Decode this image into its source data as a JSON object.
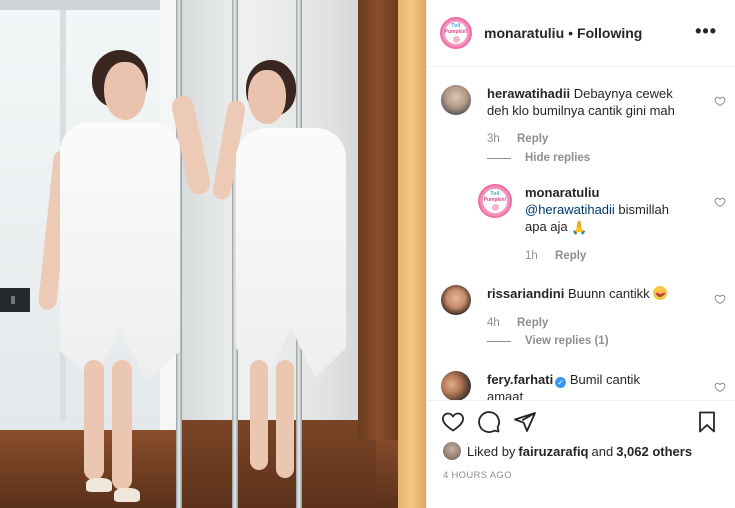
{
  "post": {
    "author": "monaratuliu",
    "separator": "•",
    "follow_status": "Following",
    "more_label": "•••",
    "avatar_text": [
      "Toll",
      "Pumpkin!"
    ]
  },
  "comments": [
    {
      "username": "herawatihadii",
      "text": "Debaynya cewek deh klo bumilnya cantik gini mah",
      "time": "3h",
      "reply_label": "Reply",
      "hide_replies_label": "Hide replies"
    },
    {
      "username": "monaratuliu",
      "mention": "@herawatihadii",
      "text": " bismillah apa aja ",
      "emoji": "🙏",
      "time": "1h",
      "reply_label": "Reply"
    },
    {
      "username": "rissariandini",
      "text": "Buunn cantikk ",
      "emoji": "heart-eyes",
      "time": "4h",
      "reply_label": "Reply",
      "view_replies_label": "View replies (1)"
    },
    {
      "username": "fery.farhati",
      "verified_mark": "✓",
      "text": "Bumil cantik amaat"
    }
  ],
  "likes": {
    "prefix": "Liked by",
    "user": "fairuzarafiq",
    "conjunction": "and",
    "others": "3,062 others"
  },
  "timestamp": "4 HOURS AGO",
  "icons": {
    "like": "heart-outline-icon",
    "comment": "comment-bubble-icon",
    "share": "paper-plane-icon",
    "save": "bookmark-icon",
    "comment_like": "small-heart-icon",
    "more": "more-dots-icon"
  },
  "colors": {
    "text": "#262626",
    "muted": "#8e8e8e",
    "mention": "#00376b",
    "verified": "#3897f0",
    "brand_ring": "#f06fa6"
  }
}
